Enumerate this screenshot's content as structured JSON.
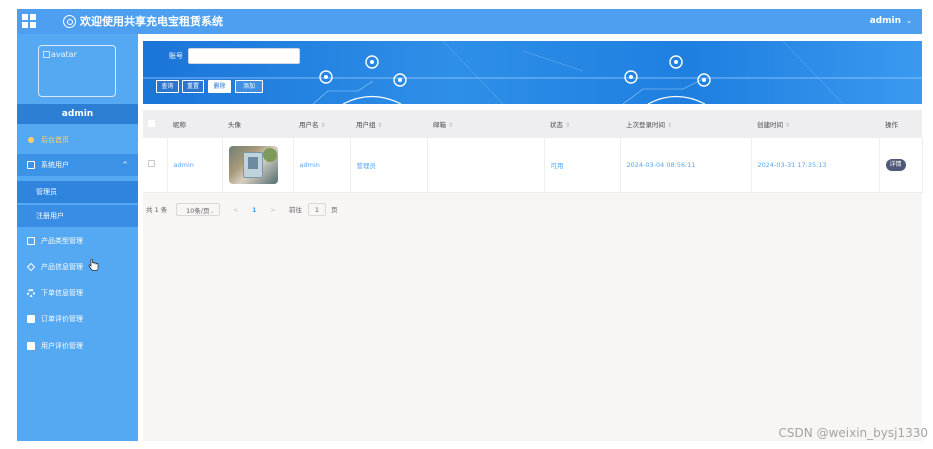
{
  "header": {
    "title": "欢迎使用共享充电宝租赁系统",
    "user_label": "admin",
    "user_caret": "⌄"
  },
  "sidebar": {
    "avatar_alt": "avatar",
    "username": "admin",
    "items": [
      {
        "label": "后台首页",
        "icon": "home-icon"
      },
      {
        "label": "系统用户",
        "icon": "user-box-icon",
        "expanded": true,
        "arrow": "^"
      },
      {
        "label": "产品类型管理",
        "icon": "product-type-icon"
      },
      {
        "label": "产品信息管理",
        "icon": "tag-icon"
      },
      {
        "label": "下单信息管理",
        "icon": "gear-icon"
      },
      {
        "label": "订单评价管理",
        "icon": "review-icon"
      },
      {
        "label": "用户评价管理",
        "icon": "user-review-icon"
      }
    ],
    "subitems": [
      {
        "label": "管理员"
      },
      {
        "label": "注册用户"
      }
    ]
  },
  "search": {
    "label": "账号",
    "value": "",
    "placeholder": "",
    "buttons": {
      "search": "查询",
      "reset": "重置",
      "delete": "删除",
      "add": "添加"
    }
  },
  "table": {
    "headers": [
      "昵称",
      "头像",
      "用户名",
      "用户组",
      "邮箱",
      "状态",
      "上次登录时间",
      "创建时间",
      "操作"
    ],
    "sort_glyph": "⇕",
    "rows": [
      {
        "nickname": "admin",
        "username": "admin",
        "group": "管理员",
        "email": "",
        "status": "可用",
        "last_login": "2024-03-04 08:56:11",
        "created": "2024-03-31 17:35:13",
        "action": "详情"
      }
    ]
  },
  "pagination": {
    "total": "共 1 条",
    "page_size": "10条/页",
    "page_size_caret": "⌄",
    "prev": "<",
    "current": "1",
    "next": ">",
    "goto_label": "前往",
    "goto_value": "1",
    "page_suffix": "页"
  },
  "watermark": "CSDN @weixin_bysj1330",
  "colors": {
    "topbar": "#4f9ff0",
    "sidebar": "#55a9f3",
    "banner": "#1b75d8",
    "link_text": "#5aa6f0",
    "detail_button": "#4f5878"
  }
}
